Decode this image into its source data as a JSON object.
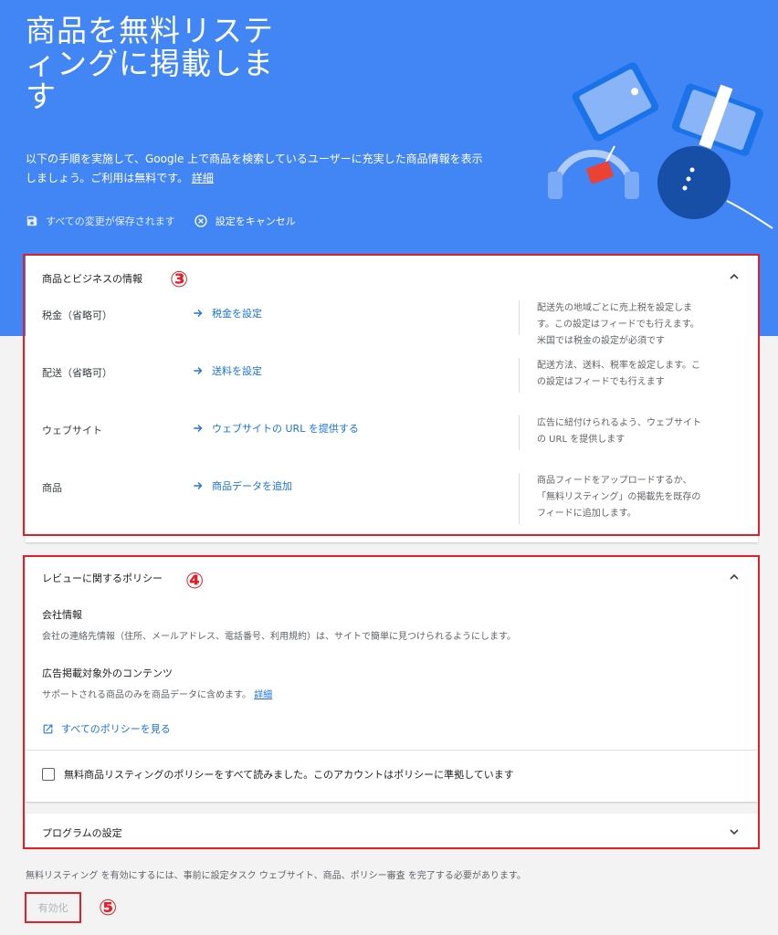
{
  "hero": {
    "title": "商品を無料リスティングに掲載します",
    "description": "以下の手順を実施して、Google 上で商品を検索しているユーザーに充実した商品情報を表示しましょう。ご利用は無料です。",
    "details_link": "詳細",
    "saved_status": "すべての変更が保存されます",
    "cancel_label": "設定をキャンセル"
  },
  "business_section": {
    "title": "商品とビジネスの情報",
    "annotation": "③",
    "rows": [
      {
        "label": "税金（省略可）",
        "link": "税金を設定",
        "help": "配送先の地域ごとに売上税を設定します。この設定はフィードでも行えます。米国では税金の設定が必須です"
      },
      {
        "label": "配送（省略可）",
        "link": "送料を設定",
        "help": "配送方法、送料、税率を設定します。この設定はフィードでも行えます"
      },
      {
        "label": "ウェブサイト",
        "link": "ウェブサイトの URL を提供する",
        "help": "広告に紐付けられるよう、ウェブサイトの URL を提供します"
      },
      {
        "label": "商品",
        "link": "商品データを追加",
        "help": "商品フィードをアップロードするか、「無料リスティング」の掲載先を既存のフィードに追加します。"
      }
    ]
  },
  "policy_section": {
    "title": "レビューに関するポリシー",
    "annotation": "④",
    "company_title": "会社情報",
    "company_desc": "会社の連絡先情報（住所、メールアドレス、電話番号、利用規約）は、サイトで簡単に見つけられるようにします。",
    "content_title": "広告掲載対象外のコンテンツ",
    "content_desc": "サポートされる商品のみを商品データに含めます。",
    "content_link": "詳細",
    "all_policies": "すべてのポリシーを見る",
    "checkbox_label": "無料商品リスティングのポリシーをすべて読みました。このアカウントはポリシーに準拠しています"
  },
  "program_section": {
    "title": "プログラムの設定"
  },
  "footer": {
    "note": "無料リスティング を有効にするには、事前に設定タスク ウェブサイト、商品、ポリシー審査 を完了する必要があります。",
    "enable_button": "有効化",
    "annotation": "⑤"
  },
  "colors": {
    "hero": "#4285f4",
    "link": "#1a73e8",
    "annotation": "#e0202a"
  }
}
